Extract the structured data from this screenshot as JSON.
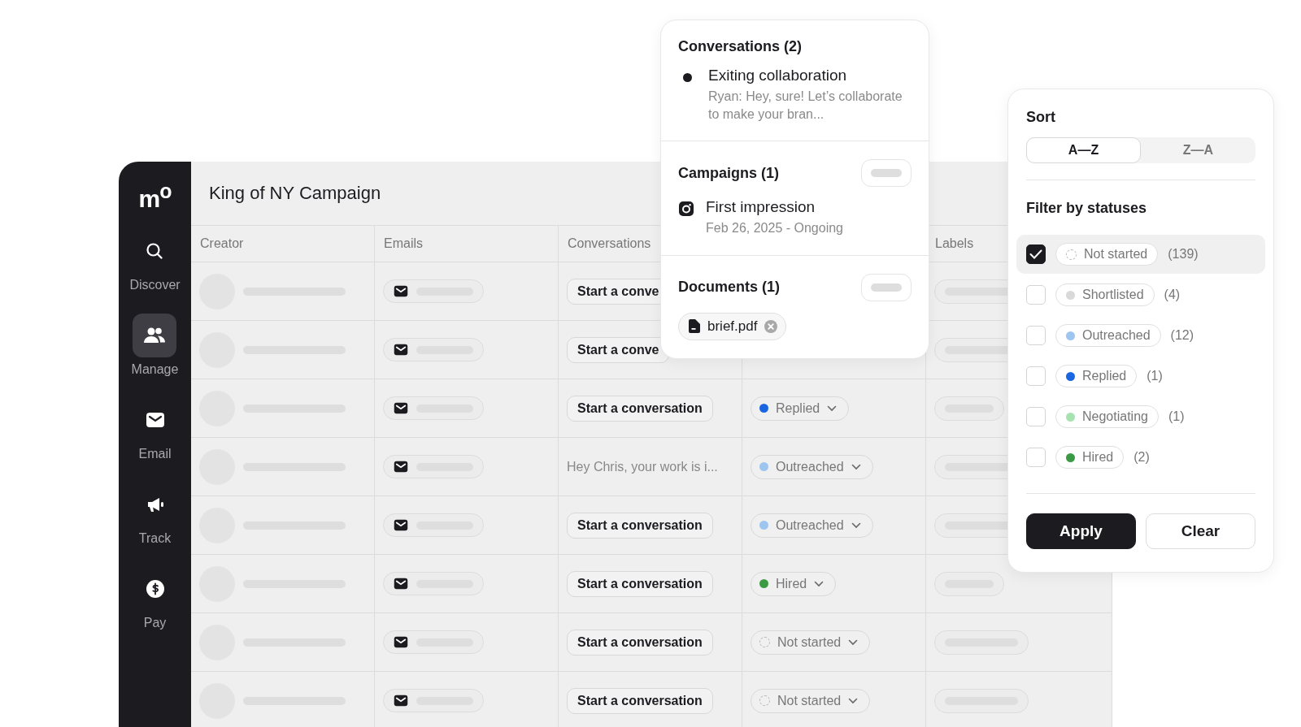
{
  "sidebar": {
    "logo": "m$^{o}$",
    "items": [
      {
        "label": "Discover",
        "kind": "search",
        "selected": false
      },
      {
        "label": "Manage",
        "kind": "people",
        "selected": true
      },
      {
        "label": "Email",
        "kind": "mail",
        "selected": false
      },
      {
        "label": "Track",
        "kind": "megaphone",
        "selected": false
      },
      {
        "label": "Pay",
        "kind": "dollar",
        "selected": false
      }
    ]
  },
  "page_title": "King of NY Campaign",
  "table": {
    "columns": [
      "Creator",
      "Emails",
      "Conversations",
      "",
      "Labels"
    ],
    "rows": [
      {
        "conversation": {
          "kind": "button",
          "text": "Start a conve"
        }
      },
      {
        "conversation": {
          "kind": "button",
          "text": "Start a conve"
        }
      },
      {
        "conversation": {
          "kind": "button",
          "text": "Start a conversation"
        },
        "status": {
          "label": "Replied",
          "kind": "dot",
          "color": "#1a66e0"
        }
      },
      {
        "conversation": {
          "kind": "message",
          "text": "Hey Chris, your work is i..."
        },
        "status": {
          "label": "Outreached",
          "kind": "dot",
          "color": "#9ec5f0"
        }
      },
      {
        "conversation": {
          "kind": "button",
          "text": "Start a conversation"
        },
        "status": {
          "label": "Outreached",
          "kind": "dot",
          "color": "#9ec5f0"
        }
      },
      {
        "conversation": {
          "kind": "button",
          "text": "Start a conversation"
        },
        "status": {
          "label": "Hired",
          "kind": "dot",
          "color": "#3c9a45"
        }
      },
      {
        "conversation": {
          "kind": "button",
          "text": "Start a conversation"
        },
        "status": {
          "label": "Not started",
          "kind": "dashed",
          "color": "#b5b5b5"
        }
      },
      {
        "conversation": {
          "kind": "button",
          "text": "Start a conversation"
        },
        "status": {
          "label": "Not started",
          "kind": "dashed",
          "color": "#b5b5b5"
        }
      }
    ]
  },
  "details_popover": {
    "conversations": {
      "title": "Conversations (2)",
      "items": [
        {
          "title": "Exiting collaboration",
          "preview": "Ryan: Hey, sure! Let’s collaborate to make your bran..."
        }
      ]
    },
    "campaigns": {
      "title": "Campaigns (1)",
      "items": [
        {
          "title": "First impression",
          "dates": "Feb 26, 2025 - Ongoing"
        }
      ]
    },
    "documents": {
      "title": "Documents (1)",
      "files": [
        "brief.pdf"
      ]
    }
  },
  "filter_popover": {
    "sort_title": "Sort",
    "sort_options": [
      {
        "label": "A—Z",
        "selected": true
      },
      {
        "label": "Z—A",
        "selected": false
      }
    ],
    "filter_title": "Filter by statuses",
    "statuses": [
      {
        "label": "Not started",
        "kind": "dashed",
        "color": "#b5b5b5",
        "count": "(139)",
        "checked": true
      },
      {
        "label": "Shortlisted",
        "kind": "dot",
        "color": "#d9d9d9",
        "count": "(4)",
        "checked": false
      },
      {
        "label": "Outreached",
        "kind": "dot",
        "color": "#9ec5f0",
        "count": "(12)",
        "checked": false
      },
      {
        "label": "Replied",
        "kind": "dot",
        "color": "#1a66e0",
        "count": "(1)",
        "checked": false
      },
      {
        "label": "Negotiating",
        "kind": "dot",
        "color": "#a6e3b0",
        "count": "(1)",
        "checked": false
      },
      {
        "label": "Hired",
        "kind": "dot",
        "color": "#3c9a45",
        "count": "(2)",
        "checked": false
      }
    ],
    "buttons": [
      "Apply",
      "Clear"
    ]
  }
}
